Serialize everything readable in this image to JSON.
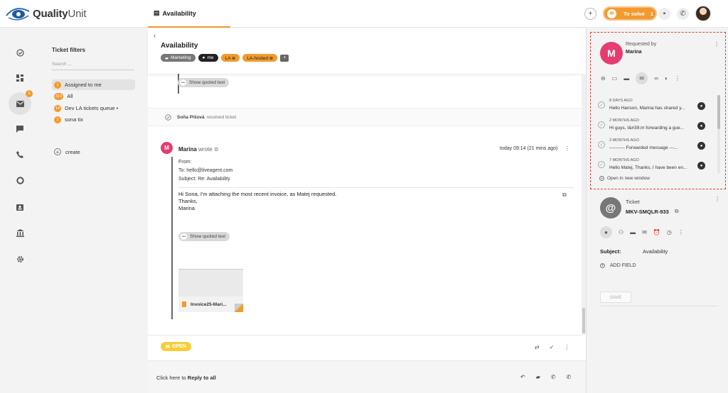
{
  "brand": {
    "name_bold": "Quality",
    "name_rest": "Unit",
    "accent": "#f29a2e",
    "contact_color": "#e63c6f"
  },
  "topbar": {
    "active_tab": "Availability",
    "to_solve_label": "To solve",
    "to_solve_count": "1"
  },
  "rail": {
    "inbox_badge": "1"
  },
  "filters": {
    "title": "Ticket filters",
    "search_placeholder": "Search ...",
    "items": [
      {
        "badge": "1",
        "label": "Assigned to me"
      },
      {
        "badge": "313",
        "label": "All"
      },
      {
        "badge": "14",
        "label": "Dev LA tickets queue •"
      },
      {
        "badge": "1",
        "label": "sona tix"
      }
    ],
    "create_label": "create"
  },
  "ticket": {
    "title": "Availability",
    "tags": [
      "Marketing",
      "me",
      "LA ⊗",
      "LA-hosted ⊗"
    ],
    "show_quoted": "Show quoted text",
    "system_event": {
      "person": "Soňa Pišová",
      "action": "resolved ticket"
    },
    "message": {
      "avatar_letter": "M",
      "author": "Marina",
      "wrote": "wrote",
      "time": "today 09:14 (21 mins ago)",
      "from_label": "From:",
      "to": "To: hello@liveagent.com",
      "subject": "Subject: Re: Availability",
      "body": [
        "Hi Sona, I'm attaching the most recent invoice, as Matej requested.",
        "Thanks,",
        "Marina"
      ],
      "attachment_name": "Invoice25-Mari..."
    },
    "status": "OPEN",
    "reply_prefix": "Click here to ",
    "reply_action": "Reply to all"
  },
  "contact": {
    "avatar_letter": "M",
    "requested_by_label": "Requested by",
    "name": "Marina",
    "history": [
      {
        "when": "8 DAYS AGO",
        "text": "Hello Hanson, Marina has shared y..."
      },
      {
        "when": "2 MONTHS AGO",
        "text": "Hi guys, I&#39;m forwarding a gue..."
      },
      {
        "when": "3 MONTHS AGO",
        "text": "---------- Forwarded message ---..."
      },
      {
        "when": "7 MONTHS AGO",
        "text": "Hello Matej, Thanks, I have been en..."
      }
    ],
    "open_new_window": "Open in new window"
  },
  "ticket_panel": {
    "label": "Ticket",
    "id": "MKV-SMQLR-933",
    "subject_label": "Subject:",
    "subject_value": "Availability",
    "add_field": "ADD FIELD",
    "save": "SAVE"
  }
}
